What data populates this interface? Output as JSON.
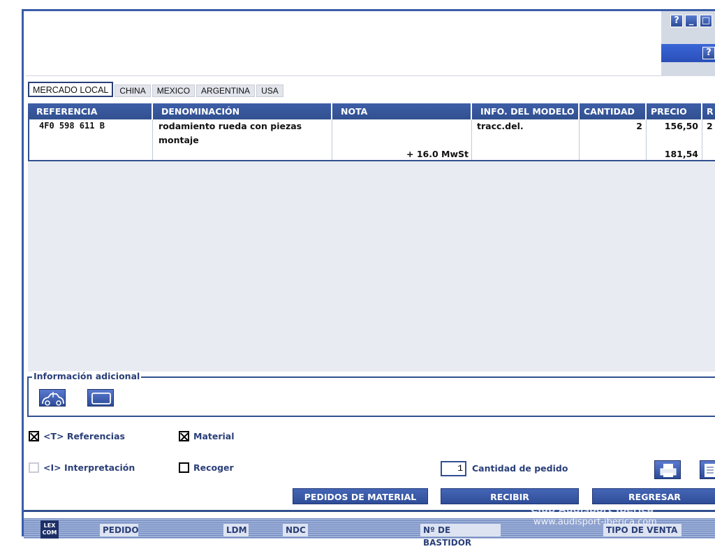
{
  "window": {
    "help_label": "?",
    "minimize_label": "_",
    "maximize_label": "□",
    "help2_label": "?"
  },
  "tabs": [
    "MERCADO LOCAL",
    "CHINA",
    "MEXICO",
    "ARGENTINA",
    "USA"
  ],
  "table": {
    "headers": [
      "REFERENCIA",
      "DENOMINACIÓN",
      "NOTA",
      "INFO. DEL MODELO",
      "CANTIDAD",
      "PRECIO",
      "R"
    ],
    "rows": [
      {
        "referencia": "4F0 598 611 B",
        "denominacion_1": "rodamiento rueda con piezas",
        "denominacion_2": "montaje",
        "nota": "+ 16.0 MwSt",
        "info_modelo": "tracc.del.",
        "cantidad": "2",
        "precio": "156,50",
        "precio_total": "181,54",
        "r": "2"
      }
    ]
  },
  "info_adicional": {
    "title": "Información adicional",
    "buttons": [
      "vehicle-icon",
      "frame-icon"
    ]
  },
  "options": {
    "referencias": {
      "label": "<T> Referencias",
      "checked": true
    },
    "material": {
      "label": "Material",
      "checked": true
    },
    "interpretacion": {
      "label": "<I> Interpretación",
      "checked": false,
      "disabled": true
    },
    "recoger": {
      "label": "Recoger",
      "checked": false
    }
  },
  "quantity": {
    "value": "1",
    "label": "Cantidad de pedido"
  },
  "actions": {
    "pedidos": "PEDIDOS DE MATERIAL",
    "recibir": "RECIBIR",
    "regresar": "REGRESAR"
  },
  "bottom_bar": {
    "logo": "LEX COM",
    "pedido": "PEDIDO",
    "ldm": "LDM",
    "ndc": "NDC",
    "bastidor": "Nº DE BASTIDOR",
    "tipo_venta": "TIPO DE VENTA"
  },
  "watermark": {
    "line1": "Club Audisport Iberica",
    "line2": "www.audisport-iberica.com"
  },
  "colors": {
    "primary": "#31508f",
    "header": "#3e5ea8",
    "panel": "#e8ebf1"
  }
}
